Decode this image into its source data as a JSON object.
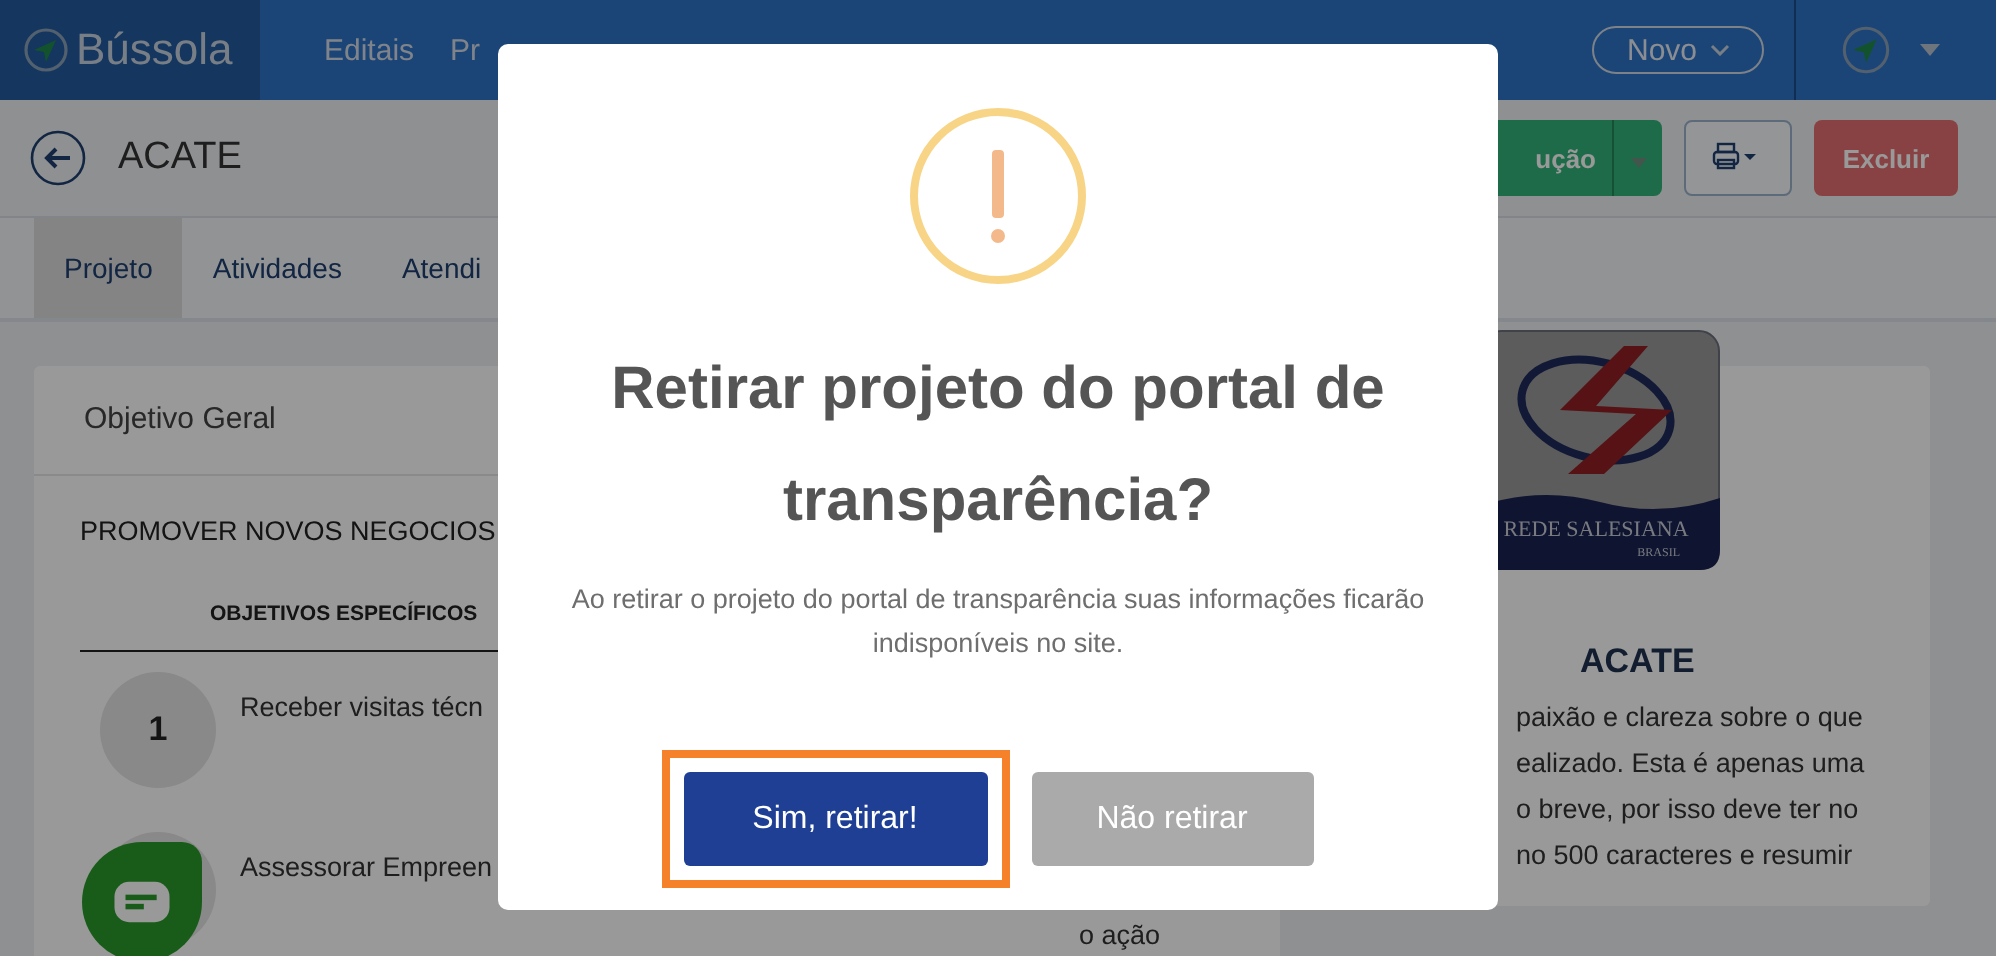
{
  "topbar": {
    "brand": "Bússola",
    "nav": [
      "Editais",
      "Pr"
    ],
    "new_button": "Novo"
  },
  "header": {
    "title": "ACATE",
    "buttons": [
      {
        "kind": "split",
        "label": "ução"
      },
      {
        "kind": "print"
      },
      {
        "kind": "danger",
        "label": "Excluir"
      }
    ]
  },
  "tabs": [
    {
      "label": "Projeto",
      "selected": true
    },
    {
      "label": "Atividades",
      "selected": false
    },
    {
      "label": "Atendi",
      "selected": false
    }
  ],
  "objective_card": {
    "title": "Objetivo Geral",
    "general": "PROMOVER NOVOS NEGOCIOS",
    "column_header": "OBJETIVOS ESPECÍFICOS",
    "rows": [
      {
        "number": "1",
        "text": "Receber visitas técn"
      },
      {
        "text": "Assessorar Empreen",
        "column_2": "o ação"
      }
    ]
  },
  "profile_card": {
    "logo_text": [
      "REDE SALESIANA",
      "BRASIL"
    ],
    "name": "ACATE",
    "description_lines": [
      "paixão e clareza sobre o que",
      "ealizado. Esta é apenas uma",
      "o breve, por isso deve ter no",
      "no 500 caracteres e resumir"
    ]
  },
  "modal": {
    "title": "Retirar projeto do portal de transparência?",
    "message": "Ao retirar o projeto do portal de transparência suas informações ficarão indisponíveis no site.",
    "buttons": [
      {
        "label": "Sim, retirar!",
        "kind": "confirm",
        "focused": true
      },
      {
        "label": "Não retirar",
        "kind": "cancel",
        "focused": false
      }
    ]
  }
}
